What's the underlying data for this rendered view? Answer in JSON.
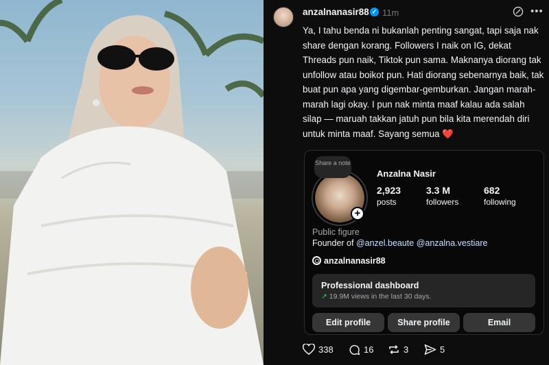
{
  "post": {
    "username": "anzalnanasir88",
    "time": "11m",
    "caption": "Ya, I tahu benda ni bukanlah penting sangat, tapi saja nak share dengan korang. Followers I naik on IG, dekat Threads pun naik, Tiktok pun sama. Maknanya diorang tak unfollow atau boikot pun. Hati diorang sebenarnya baik, tak buat pun apa yang digembar-gemburkan. Jangan marah-marah lagi okay. I pun nak minta maaf kalau ada salah silap — maruah takkan jatuh pun bila kita merendah diri untuk minta maaf. Sayang semua",
    "caption_emoji": "❤️",
    "actions": {
      "likes": "338",
      "replies": "16",
      "reposts": "3",
      "shares": "5"
    }
  },
  "profile_card": {
    "note_bubble": "Share a note",
    "name": "Anzalna Nasir",
    "stats": [
      {
        "num": "2,923",
        "label": "posts"
      },
      {
        "num": "3.3 M",
        "label": "followers"
      },
      {
        "num": "682",
        "label": "following"
      }
    ],
    "category": "Public figure",
    "founder_prefix": "Founder of",
    "founder_link1": "@anzel.beaute",
    "founder_link2": "@anzalna.vestiare",
    "threads_handle": "anzalnanasir88",
    "dashboard": {
      "title": "Professional dashboard",
      "subtitle": "19.9M views in the last 30 days."
    },
    "buttons": {
      "edit": "Edit profile",
      "share": "Share profile",
      "email": "Email"
    }
  },
  "colors": {
    "background": "#0d0d0d",
    "verified": "#0095f6",
    "heart": "#e0245e",
    "trend": "#3cc26a"
  }
}
